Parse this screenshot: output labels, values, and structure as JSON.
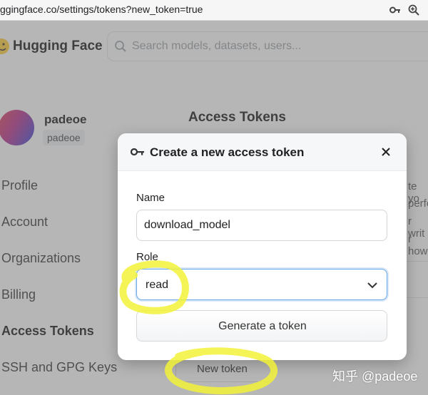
{
  "browser": {
    "url": "ggingface.co/settings/tokens?new_token=true"
  },
  "header": {
    "brand": "Hugging Face",
    "search_placeholder": "Search models, datasets, users..."
  },
  "sidebar": {
    "username": "padeoe",
    "user_badge": "padeoe",
    "items": [
      {
        "label": "Profile"
      },
      {
        "label": "Account"
      },
      {
        "label": "Organizations"
      },
      {
        "label": "Billing"
      },
      {
        "label": "Access Tokens",
        "active": true
      },
      {
        "label": "SSH and GPG Keys"
      }
    ]
  },
  "main": {
    "title": "Access Tokens",
    "bg_text_fragments": [
      "te yo",
      "perfo",
      "r writ",
      "r how"
    ],
    "new_token_label": "New token"
  },
  "modal": {
    "title": "Create a new access token",
    "name_label": "Name",
    "name_value": "download_model",
    "role_label": "Role",
    "role_value": "read",
    "generate_label": "Generate a token"
  },
  "watermark": "知乎 @padeoe",
  "colors": {
    "highlighter": "#f2f23a",
    "focus_border": "#6aa7e8",
    "logo_yellow": "#ffcc33"
  }
}
